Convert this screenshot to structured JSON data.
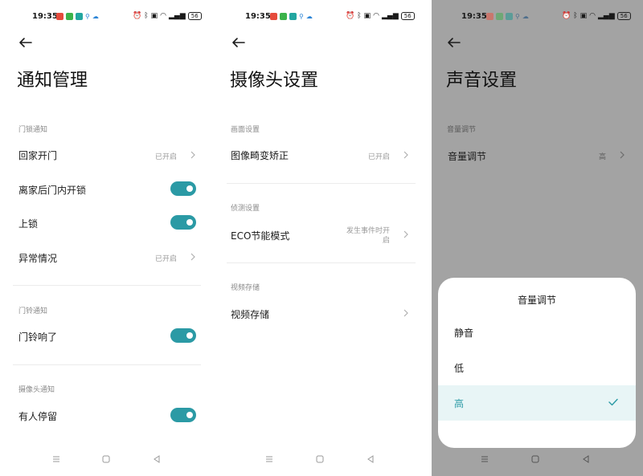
{
  "status_bar": {
    "time": "19:35",
    "battery": "56"
  },
  "screens": {
    "notification": {
      "title": "通知管理",
      "sections": [
        {
          "header": "门锁通知",
          "rows": [
            {
              "label": "回家开门",
              "value": "已开启",
              "control": "chevron"
            },
            {
              "label": "离家后门内开锁",
              "control": "toggle",
              "on": true
            },
            {
              "label": "上锁",
              "control": "toggle",
              "on": true
            },
            {
              "label": "异常情况",
              "value": "已开启",
              "control": "chevron"
            }
          ]
        },
        {
          "header": "门铃通知",
          "rows": [
            {
              "label": "门铃响了",
              "control": "toggle",
              "on": true
            }
          ]
        },
        {
          "header": "摄像头通知",
          "rows": [
            {
              "label": "有人停留",
              "control": "toggle",
              "on": true
            }
          ]
        }
      ]
    },
    "camera": {
      "title": "摄像头设置",
      "sections": [
        {
          "header": "画面设置",
          "rows": [
            {
              "label": "图像畸变矫正",
              "value": "已开启",
              "control": "chevron"
            }
          ]
        },
        {
          "header": "侦测设置",
          "rows": [
            {
              "label": "ECO节能模式",
              "value_line1": "发生事件时开",
              "value_line2": "启",
              "control": "chevron"
            }
          ]
        },
        {
          "header": "视频存储",
          "rows": [
            {
              "label": "视频存储",
              "control": "chevron"
            }
          ]
        }
      ]
    },
    "sound": {
      "title": "声音设置",
      "sections": [
        {
          "header": "音量调节",
          "rows": [
            {
              "label": "音量调节",
              "value": "高",
              "control": "chevron"
            }
          ]
        }
      ],
      "sheet": {
        "title": "音量调节",
        "options": [
          {
            "label": "静音",
            "selected": false
          },
          {
            "label": "低",
            "selected": false
          },
          {
            "label": "高",
            "selected": true
          }
        ]
      }
    }
  },
  "colors": {
    "accent": "#2b9aa5",
    "selected_bg": "#e8f5f6",
    "overlay": "#a3a3a3",
    "muted": "#9a9a9a"
  },
  "icons": [
    "back-arrow-icon",
    "chevron-right-icon",
    "checkmark-icon",
    "menu-nav-icon",
    "home-nav-icon",
    "back-nav-icon",
    "wifi-icon",
    "bluetooth-icon",
    "signal-icon",
    "alarm-icon",
    "battery-icon"
  ]
}
